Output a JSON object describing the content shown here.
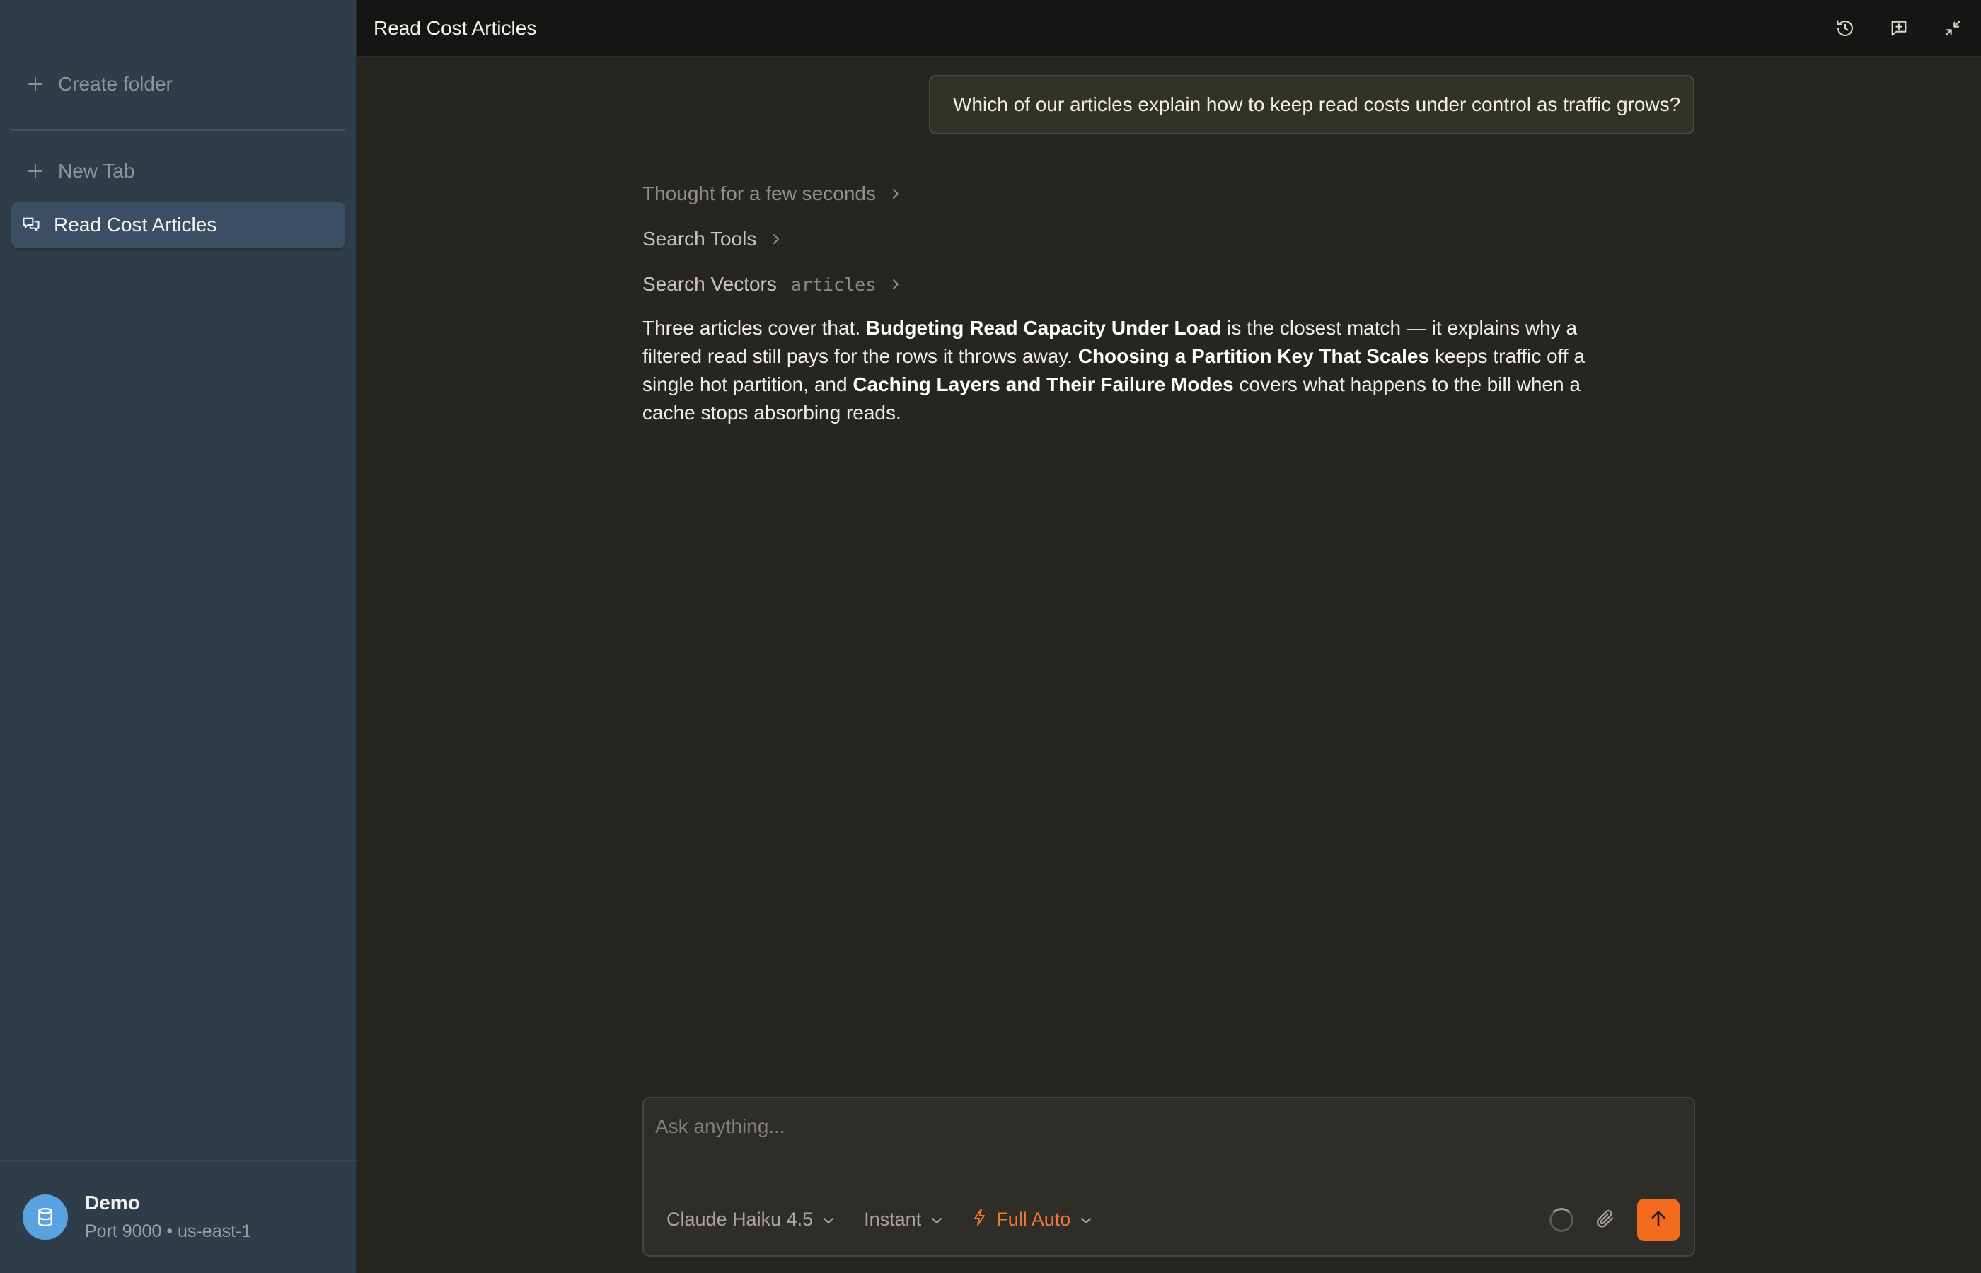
{
  "sidebar": {
    "create_folder_label": "Create folder",
    "new_tab_label": "New Tab",
    "items": [
      {
        "label": "Read Cost Articles",
        "icon": "chat-bubbles-icon",
        "active": true
      }
    ],
    "footer": {
      "title": "Demo",
      "subtitle": "Port 9000 • us-east-1",
      "avatar_icon": "database-icon"
    }
  },
  "header": {
    "title": "Read Cost Articles",
    "actions": [
      "history-icon",
      "new-chat-icon",
      "collapse-icon"
    ]
  },
  "conversation": {
    "user_message": "Which of our articles explain how to keep read costs under control as traffic grows?",
    "steps": [
      {
        "label": "Thought for a few seconds",
        "detail": ""
      },
      {
        "label": "Search Tools",
        "detail": ""
      },
      {
        "label": "Search Vectors",
        "detail": "articles"
      }
    ],
    "answer": {
      "t1": "Three articles cover that. ",
      "b1": "Budgeting Read Capacity Under Load",
      "t2": " is the closest match — it explains why a filtered read still pays for the rows it throws away. ",
      "b2": "Choosing a Partition Key That Scales",
      "t3": " keeps traffic off a single hot partition, and ",
      "b3": "Caching Layers and Their Failure Modes",
      "t4": " covers what happens to the bill when a cache stops absorbing reads."
    }
  },
  "composer": {
    "placeholder": "Ask anything...",
    "model": "Claude Haiku 4.5",
    "mode": "Instant",
    "autonomy": "Full Auto"
  },
  "colors": {
    "accent": "#f26a1b",
    "sidebar_bg": "#2f3d4a",
    "main_bg": "#272520"
  }
}
